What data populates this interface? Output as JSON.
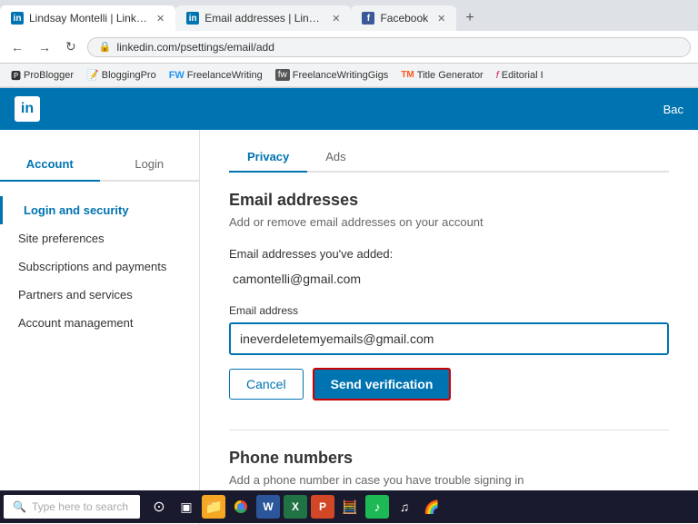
{
  "browser": {
    "tabs": [
      {
        "id": "tab1",
        "title": "Lindsay Montelli | LinkedIn",
        "favicon": "li",
        "active": true
      },
      {
        "id": "tab2",
        "title": "Email addresses | LinkedIn",
        "favicon": "li",
        "active": false
      },
      {
        "id": "tab3",
        "title": "Facebook",
        "favicon": "fb",
        "active": false
      }
    ],
    "url": "linkedin.com/psettings/email/add",
    "new_tab_label": "+",
    "bookmarks": [
      "ProBlogger",
      "BloggingPro",
      "FreelanceWriting",
      "FreelanceWritingGigs",
      "Title Generator",
      "Editorial I"
    ]
  },
  "linkedin": {
    "header": {
      "logo": "in",
      "back_label": "Bac"
    },
    "tabs": [
      {
        "label": "Account",
        "active": true
      },
      {
        "label": "Login",
        "active": false
      },
      {
        "label": "Privacy",
        "active": false
      },
      {
        "label": "Ads",
        "active": false
      }
    ],
    "sidebar": {
      "items": [
        {
          "label": "Login and security",
          "active": true
        },
        {
          "label": "Site preferences",
          "active": false
        },
        {
          "label": "Subscriptions and payments",
          "active": false
        },
        {
          "label": "Partners and services",
          "active": false
        },
        {
          "label": "Account management",
          "active": false
        }
      ]
    },
    "content": {
      "email_section": {
        "title": "Email addresses",
        "subtitle": "Add or remove email addresses on your account",
        "emails_label": "Email addresses you've added:",
        "existing_email": "camontelli@gmail.com",
        "form_label": "Email address",
        "input_value": "ineverdeletemyemails@gmail.com",
        "cancel_label": "Cancel",
        "send_label": "Send verification"
      },
      "phone_section": {
        "title": "Phone numbers",
        "subtitle": "Add a phone number in case you have trouble signing in"
      }
    }
  },
  "taskbar": {
    "search_placeholder": "Type here to search",
    "icons": [
      "⊙",
      "▣",
      "📁",
      "🌐",
      "W",
      "X",
      "P",
      "🧮",
      "🎵",
      "🎵",
      "🌈"
    ]
  }
}
